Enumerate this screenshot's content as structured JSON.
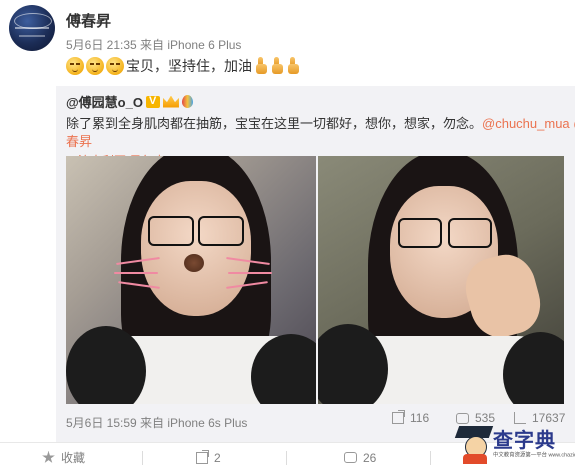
{
  "post": {
    "author": "傅春昇",
    "meta": "5月6日 21:35 来自 iPhone 6 Plus",
    "text": "宝贝，坚持住，加油",
    "emojis": [
      "weary-face",
      "weary-face",
      "weary-face"
    ],
    "trailing_icons": [
      "thumbs-up",
      "thumbs-up",
      "thumbs-up"
    ]
  },
  "quote": {
    "author": "@傅园慧o_O",
    "text": "除了累到全身肌肉都在抽筋，宝宝在这里一切都好，想你，想家，勿念。",
    "mention1": "@chuchu_mua",
    "mention2": "@傅",
    "mention2_cont": "春昇",
    "location": "澳大利亚 墨尔本",
    "time": "5月6日 15:59 来自 iPhone 6s Plus",
    "reposts": "116",
    "comments": "535",
    "likes": "17637"
  },
  "actions": {
    "favorite": "收藏",
    "repost": "2",
    "comment": "26"
  },
  "watermark": {
    "title": "查字典",
    "subtitle": "中文教育资源第一平台 www.chazidian.com"
  },
  "colors": {
    "accent": "#eb7350",
    "meta_gray": "#808080",
    "quote_bg": "#f2f2f5"
  }
}
